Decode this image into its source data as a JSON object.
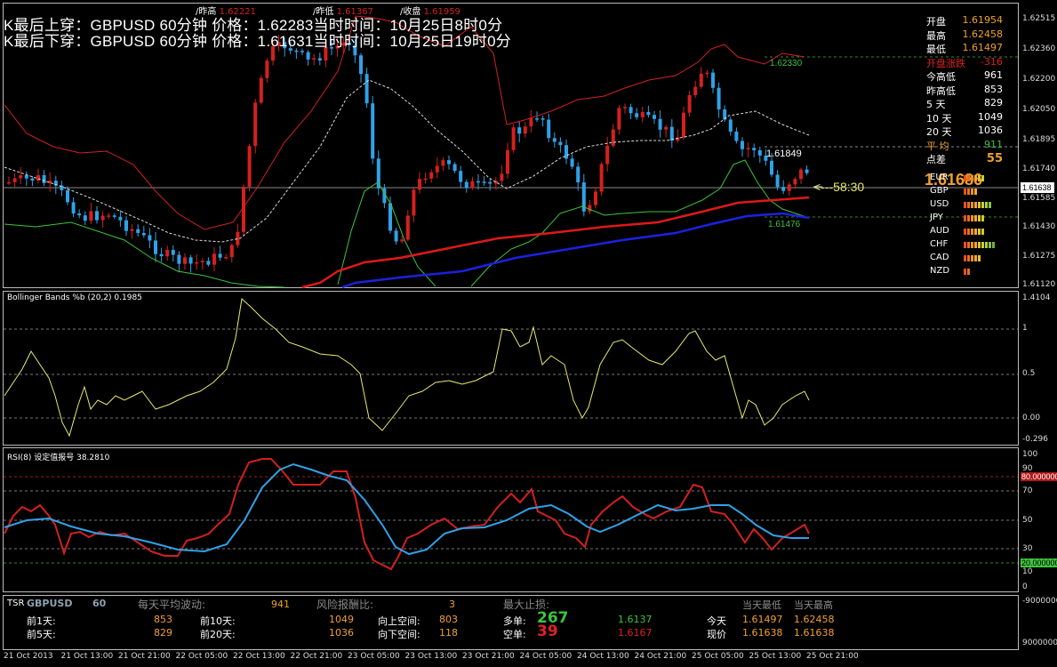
{
  "header": {
    "line1": "K最后上穿：GBPUSD 60分钟 价格：1.62283当时时间：10月25日8时0分",
    "line2": "K最后下穿：GBPUSD 60分钟 价格：1.61631当时时间：10月25日19时0分",
    "top_hi_label": "/昨高",
    "top_hi_value": "1.62221",
    "top_lo_label": "/昨低",
    "top_lo_value": "1.61367",
    "top_close_label": "/收盘",
    "top_close_value": "1.61959"
  },
  "colors": {
    "up": "#d42020",
    "down": "#2fa2e8",
    "band_red": "#d42020",
    "band_green": "#3ec43e",
    "ma_blue": "#1a22e0",
    "rsi_blue": "#2fa2e8",
    "orange": "#f0a030"
  },
  "price_axis": [
    "1.62515",
    "1.62360",
    "1.62200",
    "1.62050",
    "1.61895",
    "1.61740",
    "1.61585",
    "1.61430",
    "1.61275",
    "1.61120"
  ],
  "current_price_tag": "1.61638",
  "big_price": "1.61686",
  "countdown": "<---58:30",
  "level_labels": {
    "band_top": "1.62330",
    "last_high": "1.61849",
    "band_low": "1.61476"
  },
  "info_panel": [
    {
      "k": "开盘",
      "v": "1.61954",
      "kc": "#ffffff",
      "vc": "#f0a030"
    },
    {
      "k": "最高",
      "v": "1.62458",
      "kc": "#ffffff",
      "vc": "#f0a030"
    },
    {
      "k": "最低",
      "v": "1.61497",
      "kc": "#ffffff",
      "vc": "#f0a030"
    },
    {
      "k": "开盘涨跌",
      "v": "-316",
      "kc": "#e02020",
      "vc": "#e02020"
    },
    {
      "k": "今高低",
      "v": "961",
      "kc": "#ffffff",
      "vc": "#ffffff"
    },
    {
      "k": "昨高低",
      "v": "853",
      "kc": "#ffffff",
      "vc": "#ffffff"
    },
    {
      "k": "5  天",
      "v": "829",
      "kc": "#ffffff",
      "vc": "#ffffff"
    },
    {
      "k": "10 天",
      "v": "1049",
      "kc": "#ffffff",
      "vc": "#ffffff"
    },
    {
      "k": "20 天",
      "v": "1036",
      "kc": "#ffffff",
      "vc": "#ffffff"
    },
    {
      "k": "平  均",
      "v": "911",
      "kc": "#f0a030",
      "vc": "#3ec43e"
    },
    {
      "k": "点差",
      "v": "55",
      "kc": "#ffffff",
      "vc": "#f0a030"
    }
  ],
  "currencies": [
    {
      "name": "EUR",
      "bars": 6
    },
    {
      "name": "GBP",
      "bars": 4
    },
    {
      "name": "USD",
      "bars": 8
    },
    {
      "name": "JPY",
      "bars": 6
    },
    {
      "name": "AUD",
      "bars": 6
    },
    {
      "name": "CHF",
      "bars": 9
    },
    {
      "name": "CAD",
      "bars": 5
    },
    {
      "name": "NZD",
      "bars": 2
    }
  ],
  "bb_panel": {
    "title": "Bollinger Bands %b (20,2) 0.1985",
    "axis": [
      "1.4104",
      "1",
      "0.5",
      "0.00",
      "-0.296"
    ]
  },
  "rsi_panel": {
    "title": "RSI(8) 设定值报号 38.2810",
    "axis": [
      "100",
      "90",
      "70",
      "50",
      "30",
      "10",
      "0"
    ],
    "level_hi": "80.000000",
    "level_lo": "20.000000"
  },
  "tsr_panel": {
    "tsr": "TSR",
    "symbol": "GBPUSD",
    "period": "60",
    "avg_label": "每天平均波动:",
    "avg_value": "941",
    "risk_label": "风险报酬比:",
    "risk_value": "3",
    "stop_label": "最大止损:",
    "d1_label": "前1天:",
    "d1_value": "853",
    "d5_label": "前5天:",
    "d5_value": "829",
    "d10_label": "前10天:",
    "d10_value": "1049",
    "d20_label": "前20天:",
    "d20_value": "1036",
    "up_space_label": "向上空间:",
    "up_space_value": "803",
    "down_space_label": "向下空间:",
    "down_space_value": "118",
    "long_label": "多单:",
    "long_value": "267",
    "long_price": "1.6137",
    "short_label": "空单:",
    "short_value": "39",
    "short_price": "1.6167",
    "today_lo_hdr": "当天最低",
    "today_hi_hdr": "当天最高",
    "today_label": "今天",
    "today_lo": "1.61497",
    "today_hi": "1.62458",
    "now_label": "现价",
    "now_lo": "1.61638",
    "now_hi": "1.61638",
    "axis_top": "-9000000",
    "axis_bottom": "9000000"
  },
  "time_axis": [
    "21 Oct 2013",
    "21 Oct 13:00",
    "21 Oct 21:00",
    "22 Oct 05:00",
    "22 Oct 13:00",
    "22 Oct 21:00",
    "23 Oct 05:00",
    "23 Oct 13:00",
    "23 Oct 21:00",
    "24 Oct 05:00",
    "24 Oct 13:00",
    "24 Oct 21:00",
    "25 Oct 05:00",
    "25 Oct 13:00",
    "25 Oct 21:00"
  ]
}
